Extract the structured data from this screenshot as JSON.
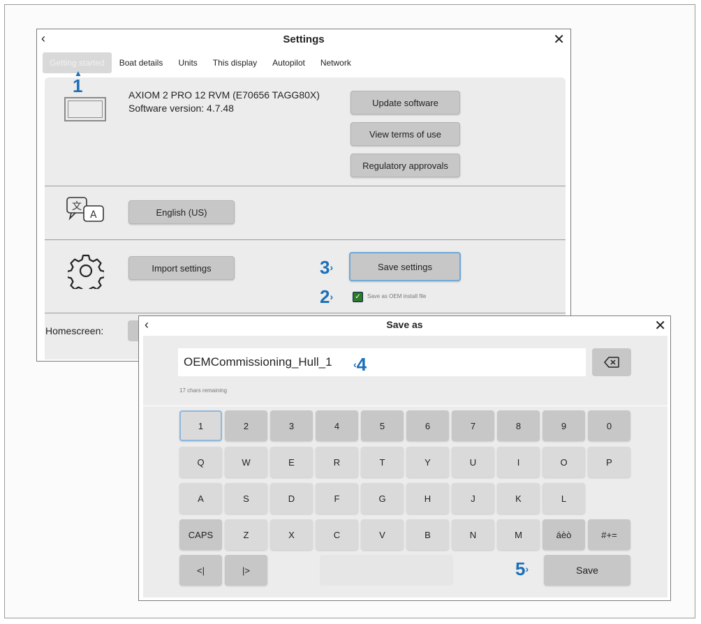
{
  "settings": {
    "title": "Settings",
    "back_icon": "‹",
    "close_icon": "✕",
    "tabs": [
      "Getting started",
      "Boat details",
      "Units",
      "This display",
      "Autopilot",
      "Network"
    ],
    "device_name": "AXIOM 2 PRO 12 RVM (E70656 TAGG80X)",
    "software_version": "Software version: 4.7.48",
    "buttons": {
      "update": "Update software",
      "terms": "View terms of use",
      "regulatory": "Regulatory approvals",
      "language": "English (US)",
      "import": "Import settings",
      "save": "Save settings"
    },
    "oem_checkbox_label": "Save as OEM install file",
    "homescreen_label": "Homescreen:"
  },
  "markers": {
    "m1": "1",
    "m2": "2",
    "m3": "3",
    "m4": "4",
    "m5": "5",
    "arrow": "›",
    "up_arrow": "▲"
  },
  "save_as": {
    "title": "Save as",
    "back_icon": "‹",
    "close_icon": "✕",
    "filename": "OEMCommissioning_Hull_1",
    "chars_remaining": "17 chars remaining",
    "keyboard": {
      "row1": [
        "1",
        "2",
        "3",
        "4",
        "5",
        "6",
        "7",
        "8",
        "9",
        "0"
      ],
      "row2": [
        "Q",
        "W",
        "E",
        "R",
        "T",
        "Y",
        "U",
        "I",
        "O",
        "P"
      ],
      "row3": [
        "A",
        "S",
        "D",
        "F",
        "G",
        "H",
        "J",
        "K",
        "L"
      ],
      "row4": [
        "CAPS",
        "Z",
        "X",
        "C",
        "V",
        "B",
        "N",
        "M",
        "áèò",
        "#+="
      ],
      "cursor_left": "<|",
      "cursor_right": "|>",
      "save": "Save"
    }
  },
  "colors": {
    "accent": "#1d6fb8",
    "key": "#c7c7c7",
    "panel": "#ececec",
    "check": "#2a7a2a"
  }
}
